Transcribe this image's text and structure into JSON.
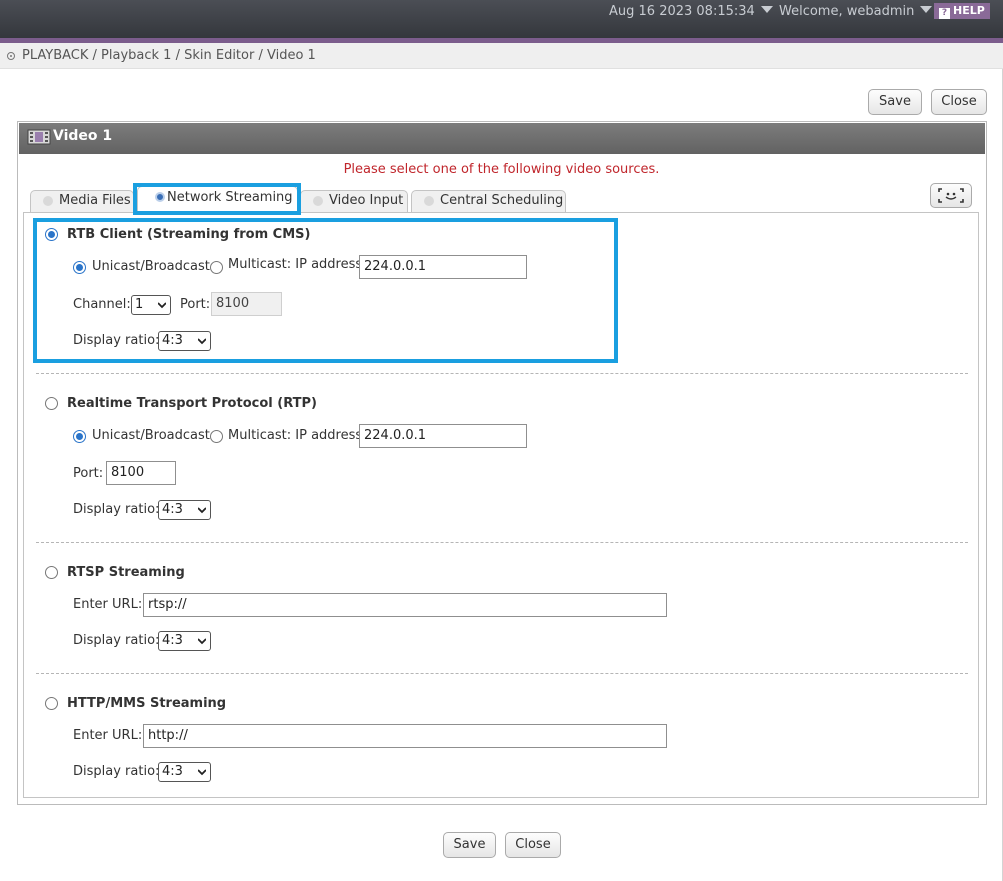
{
  "topbar": {
    "datetime": "Aug 16 2023 08:15:34",
    "welcome": "Welcome, webadmin",
    "help": "HELP",
    "help_glyph": "?"
  },
  "breadcrumb": "PLAYBACK / Playback 1 / Skin Editor / Video 1",
  "buttons": {
    "save": "Save",
    "close": "Close"
  },
  "panel": {
    "title": "Video 1",
    "icon": "film-icon"
  },
  "instruction": "Please select one of the following video sources.",
  "tabs": [
    {
      "label": "Media Files",
      "active": false
    },
    {
      "label": "Network Streaming",
      "active": true
    },
    {
      "label": "Video Input",
      "active": false
    },
    {
      "label": "Central Scheduling",
      "active": false
    }
  ],
  "colors": {
    "highlight": "#1a9fe0",
    "instruction": "#c0262c",
    "accent": "#7b5c8c",
    "radio_selected": "#2a74c9"
  },
  "rtb": {
    "title": "RTB Client (Streaming from CMS)",
    "selected": true,
    "unicast_label": "Unicast/Broadcast",
    "multicast_label": "Multicast: IP address",
    "mode": "Unicast/Broadcast",
    "ip": "224.0.0.1",
    "channel_label": "Channel:",
    "channel": "1",
    "port_label": "Port:",
    "port": "8100",
    "ratio_label": "Display ratio:",
    "ratio": "4:3"
  },
  "rtp": {
    "title": "Realtime Transport Protocol (RTP)",
    "selected": false,
    "unicast_label": "Unicast/Broadcast",
    "multicast_label": "Multicast: IP address",
    "mode": "Unicast/Broadcast",
    "ip": "224.0.0.1",
    "port_label": "Port:",
    "port": "8100",
    "ratio_label": "Display ratio:",
    "ratio": "4:3"
  },
  "rtsp": {
    "title": "RTSP Streaming",
    "selected": false,
    "url_label": "Enter URL:",
    "url": "rtsp://",
    "ratio_label": "Display ratio:",
    "ratio": "4:3"
  },
  "http": {
    "title": "HTTP/MMS Streaming",
    "selected": false,
    "url_label": "Enter URL:",
    "url": "http://",
    "ratio_label": "Display ratio:",
    "ratio": "4:3"
  }
}
